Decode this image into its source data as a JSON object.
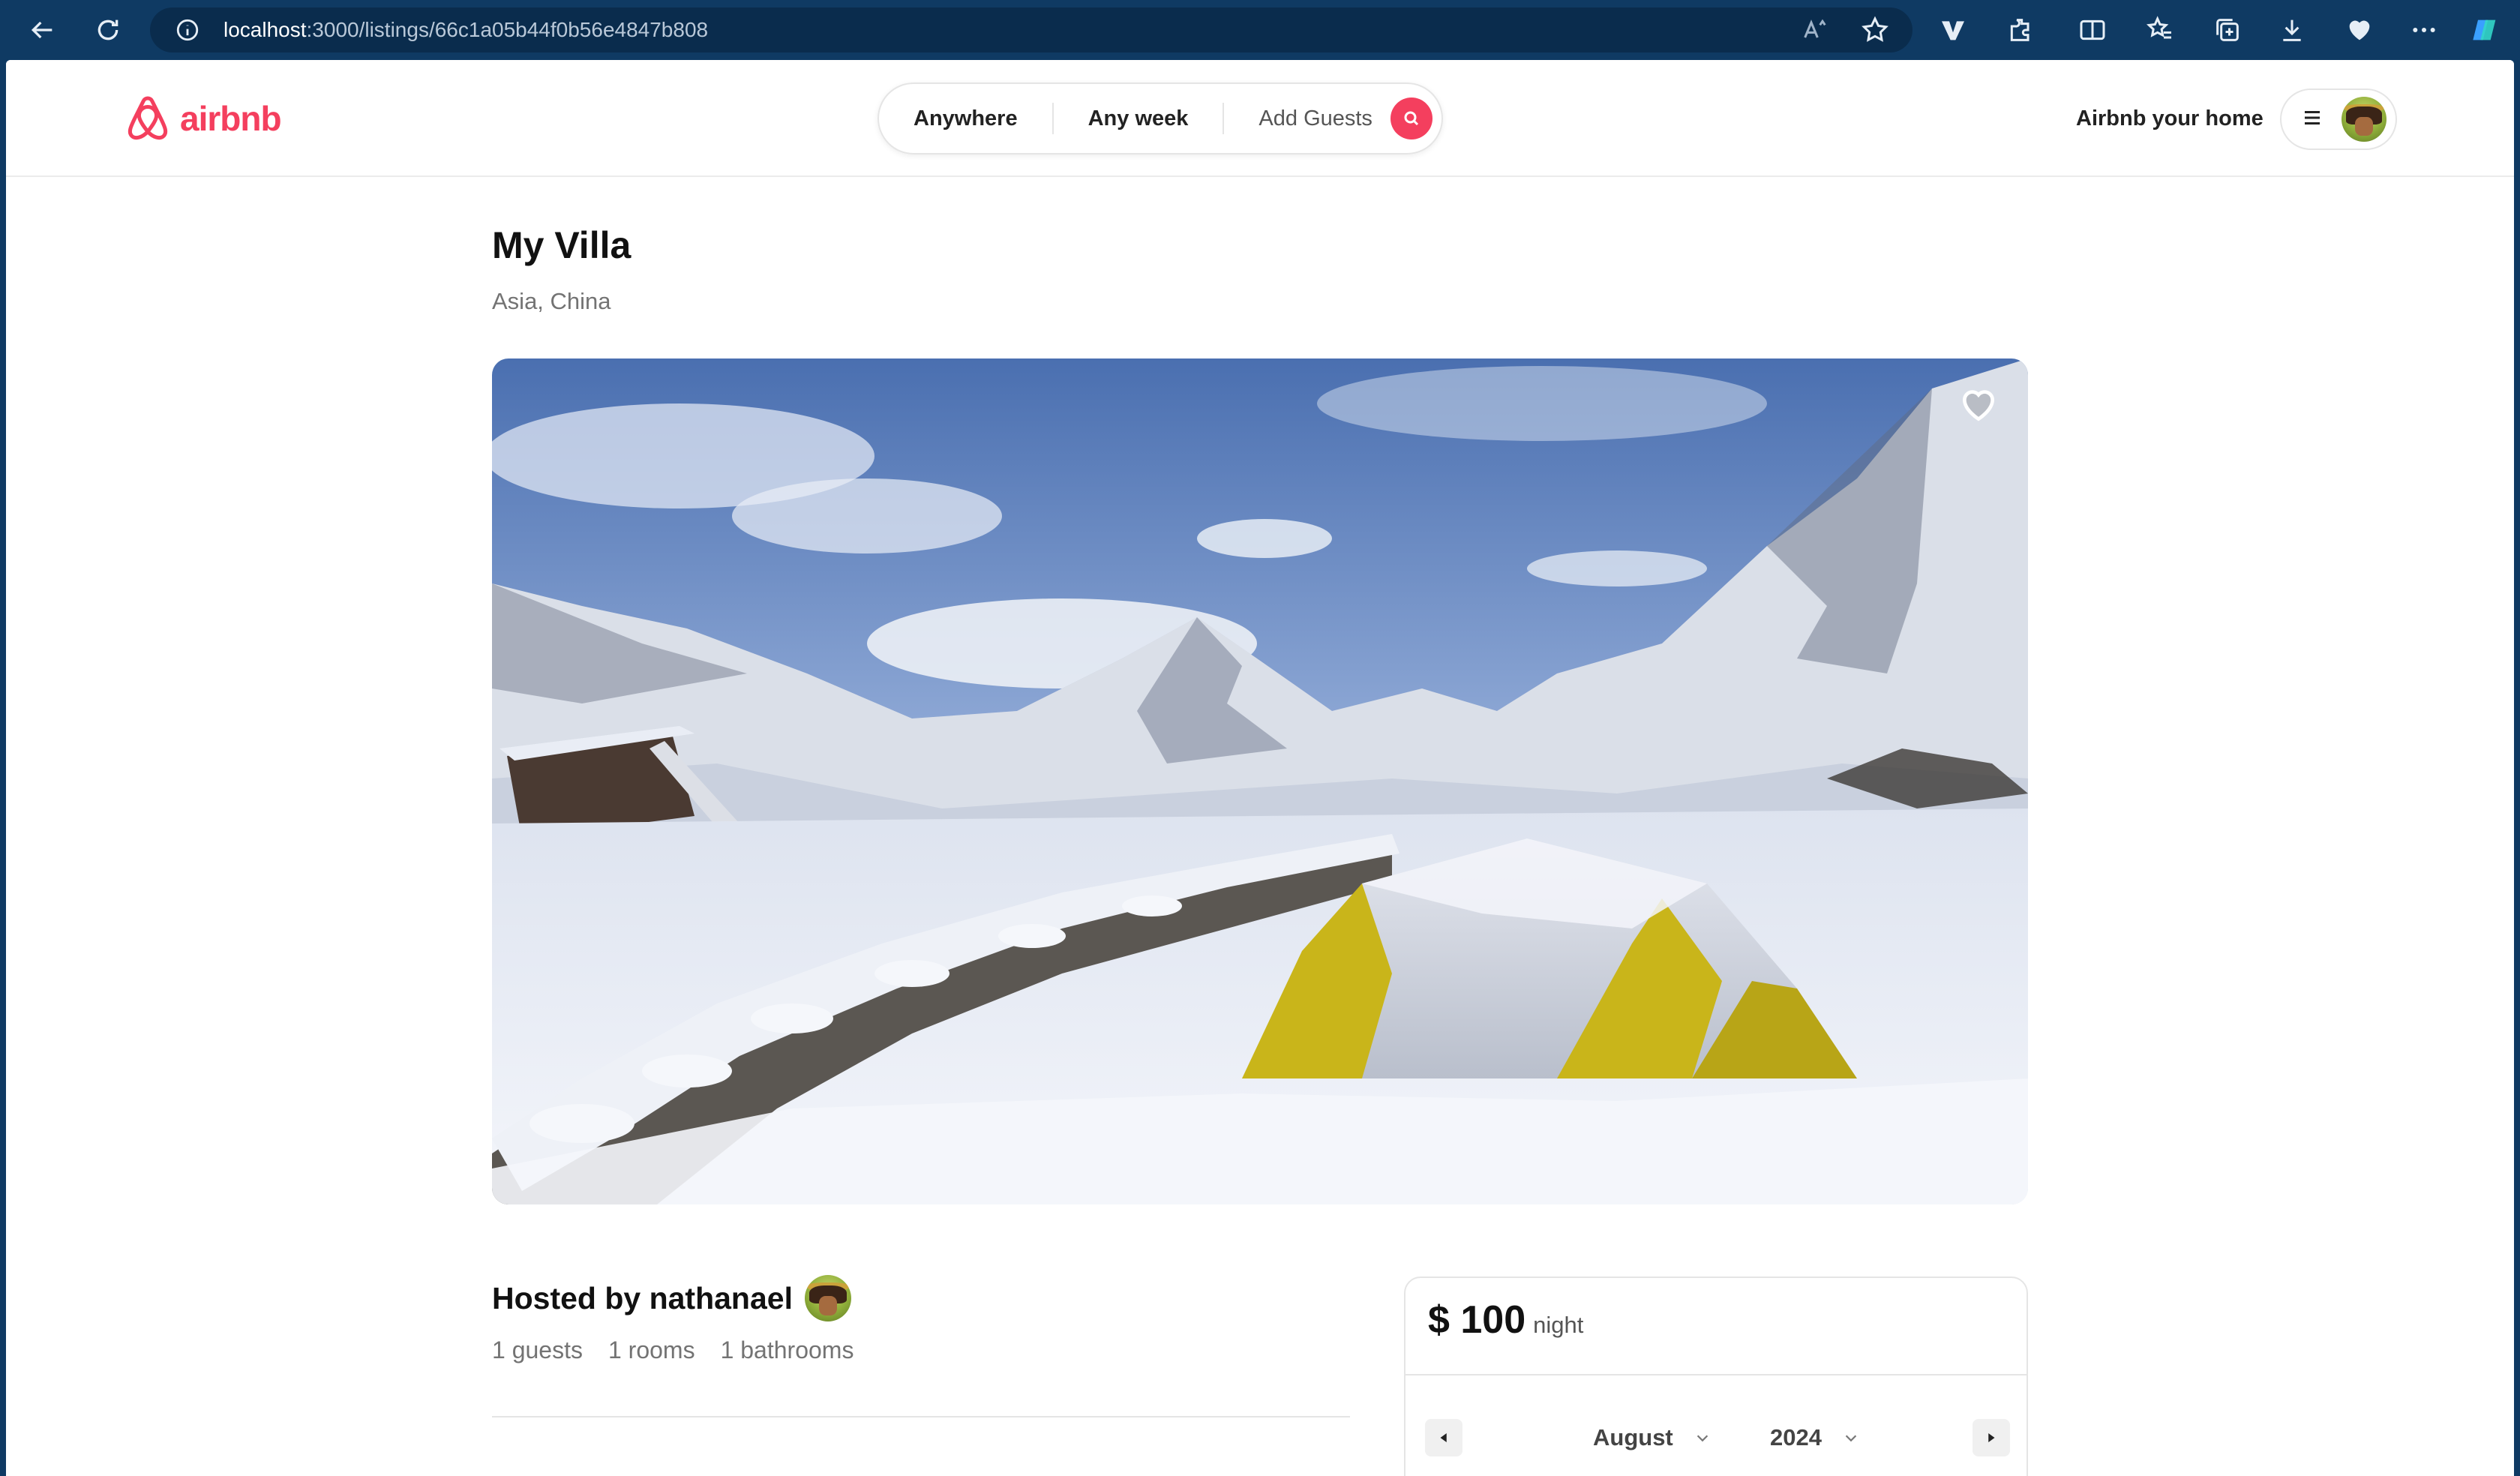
{
  "browser": {
    "url_host": "localhost",
    "url_path": ":3000/listings/66c1a05b44f0b56e4847b808"
  },
  "navbar": {
    "logo_text": "airbnb",
    "search": {
      "where": "Anywhere",
      "when": "Any week",
      "guests": "Add Guests"
    },
    "host_link": "Airbnb your home"
  },
  "listing": {
    "title": "My Villa",
    "location": "Asia, China",
    "host_label": "Hosted by nathanael",
    "stats": {
      "guests": "1 guests",
      "rooms": "1 rooms",
      "bathrooms": "1 bathrooms"
    }
  },
  "booking": {
    "price": "$ 100",
    "price_unit": "night",
    "calendar": {
      "month": "August",
      "year": "2024"
    }
  },
  "colors": {
    "brand": "#f43f5e",
    "chrome": "#0f3a63"
  }
}
